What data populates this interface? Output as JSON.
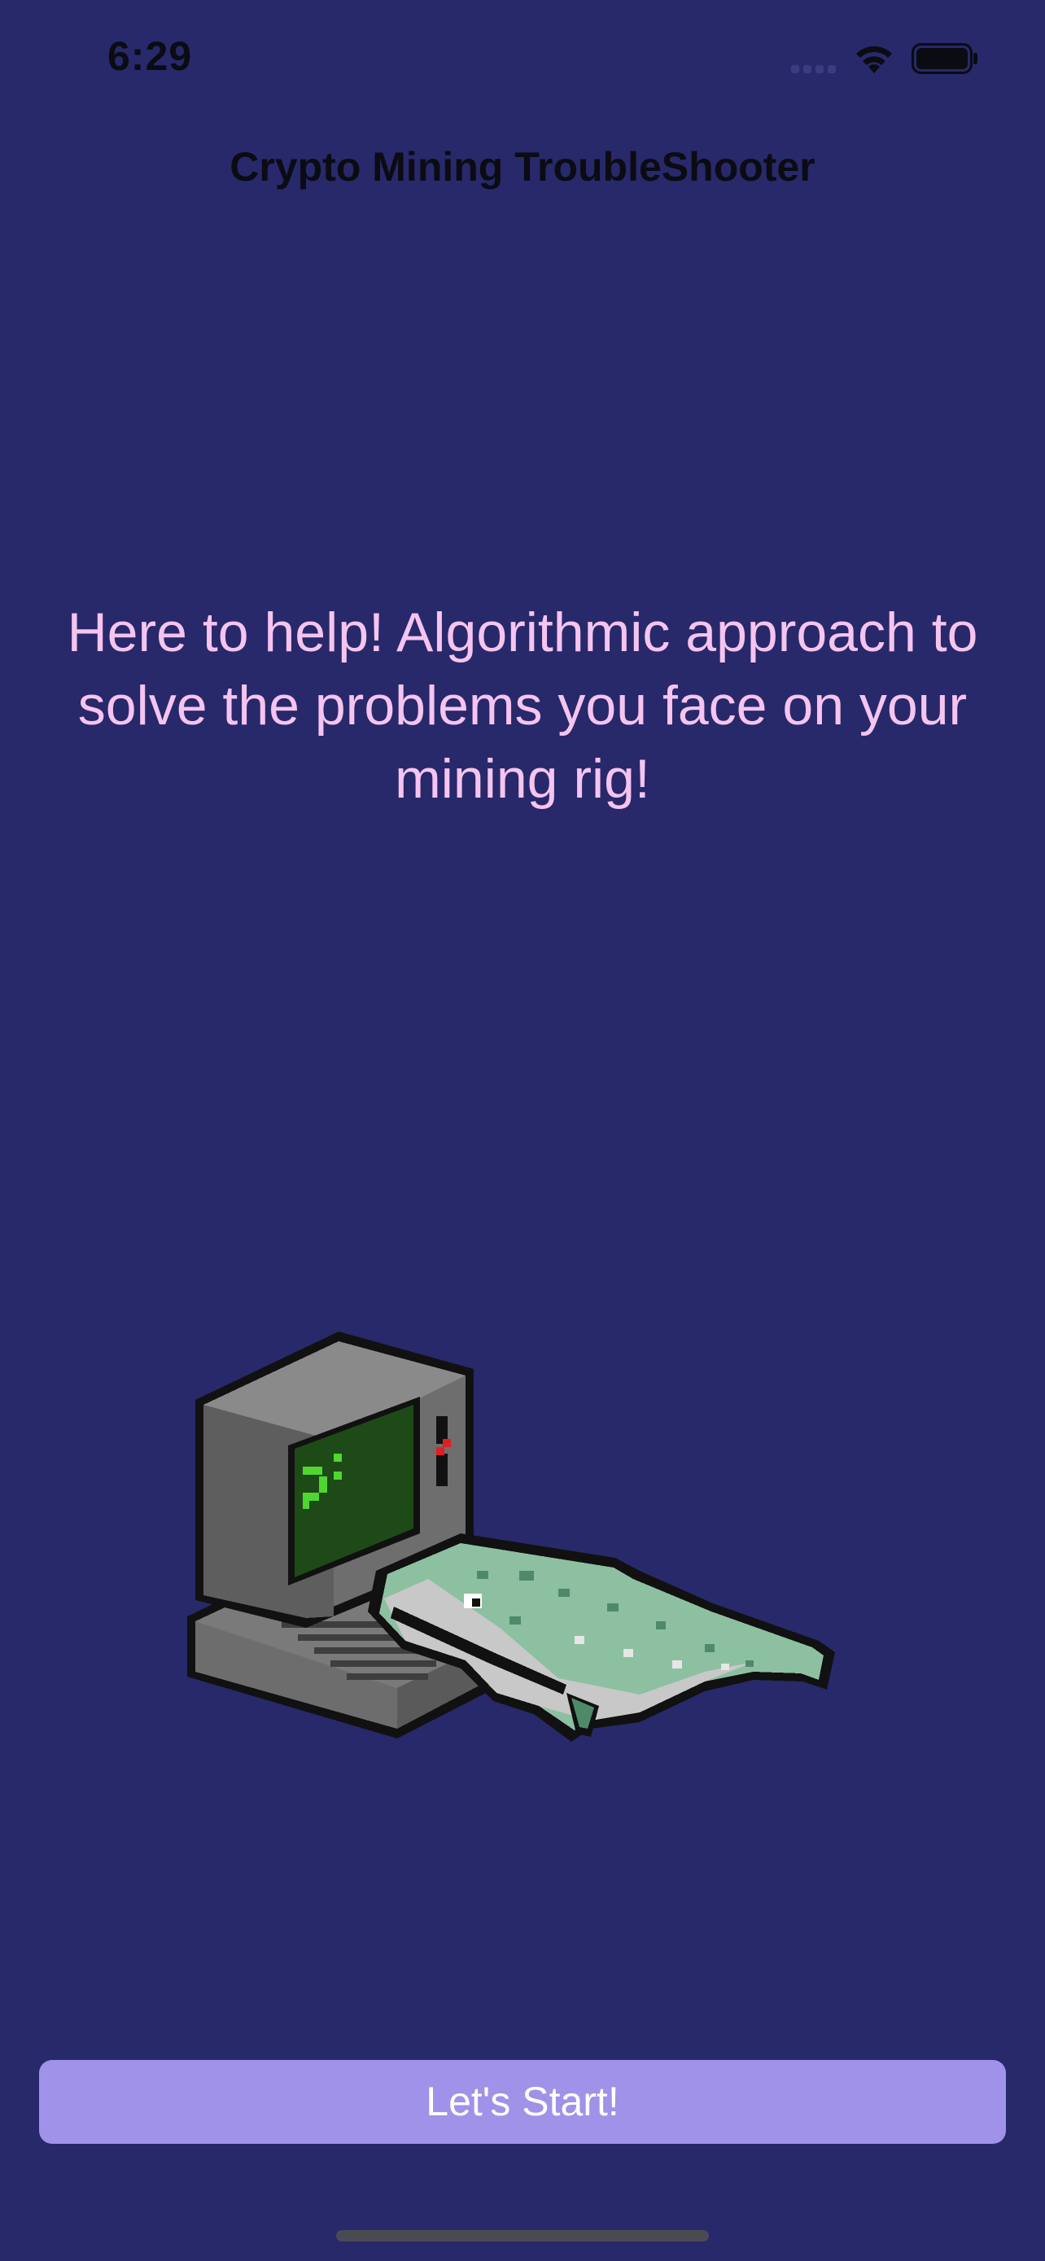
{
  "status_bar": {
    "time": "6:29",
    "icons": [
      "cellular-signal-icon",
      "wifi-icon",
      "battery-icon"
    ]
  },
  "navigation": {
    "title": "Crypto Mining TroubleShooter"
  },
  "main": {
    "tagline": "Here to help! Algorithmic approach to solve the problems you face on your mining rig!",
    "illustration": "pixel-art-computer-with-whale"
  },
  "actions": {
    "start_label": "Let's Start!"
  },
  "colors": {
    "background": "#27296b",
    "title_text": "#0b0b12",
    "tagline_text": "#f5c4ef",
    "button_background": "#a092e8",
    "button_text": "#ffffff"
  }
}
